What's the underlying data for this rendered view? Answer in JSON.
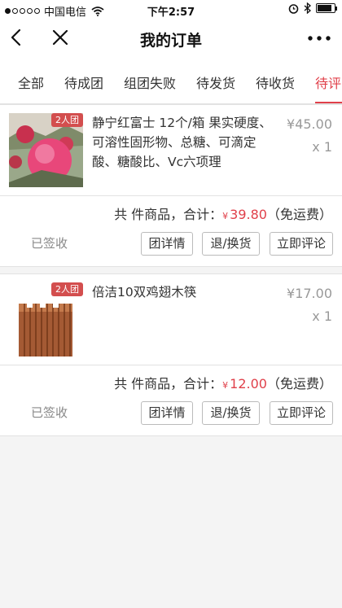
{
  "status_bar": {
    "carrier": "中国电信",
    "time": "下午2:57"
  },
  "nav": {
    "title": "我的订单"
  },
  "tabs": [
    {
      "label": "全部"
    },
    {
      "label": "待成团"
    },
    {
      "label": "组团失败"
    },
    {
      "label": "待发货"
    },
    {
      "label": "待收货"
    },
    {
      "label": "待评"
    }
  ],
  "orders": [
    {
      "badge": "2人团",
      "name": "静宁红富士 12个/箱 果实硬度、可溶性固形物、总糖、可滴定酸、糖酸比、Vc六项理",
      "price": "¥45.00",
      "qty": "x 1",
      "summary_prefix": "共 件商品，合计：",
      "currency": "¥",
      "total": "39.80",
      "shipping": "（免运费）",
      "status": "已签收",
      "buttons": [
        "团详情",
        "退/换货",
        "立即评论"
      ]
    },
    {
      "badge": "2人团",
      "name": "倍洁10双鸡翅木筷",
      "price": "¥17.00",
      "qty": "x 1",
      "summary_prefix": "共 件商品，合计：",
      "currency": "¥",
      "total": "12.00",
      "shipping": "（免运费）",
      "status": "已签收",
      "buttons": [
        "团详情",
        "退/换货",
        "立即评论"
      ]
    }
  ],
  "colors": {
    "accent": "#e0404a",
    "badge": "#d34e4e"
  },
  "icons": [
    "signal-dots-icon",
    "wifi-icon",
    "alarm-icon",
    "bluetooth-icon",
    "battery-icon",
    "back-icon",
    "close-icon",
    "more-icon"
  ]
}
